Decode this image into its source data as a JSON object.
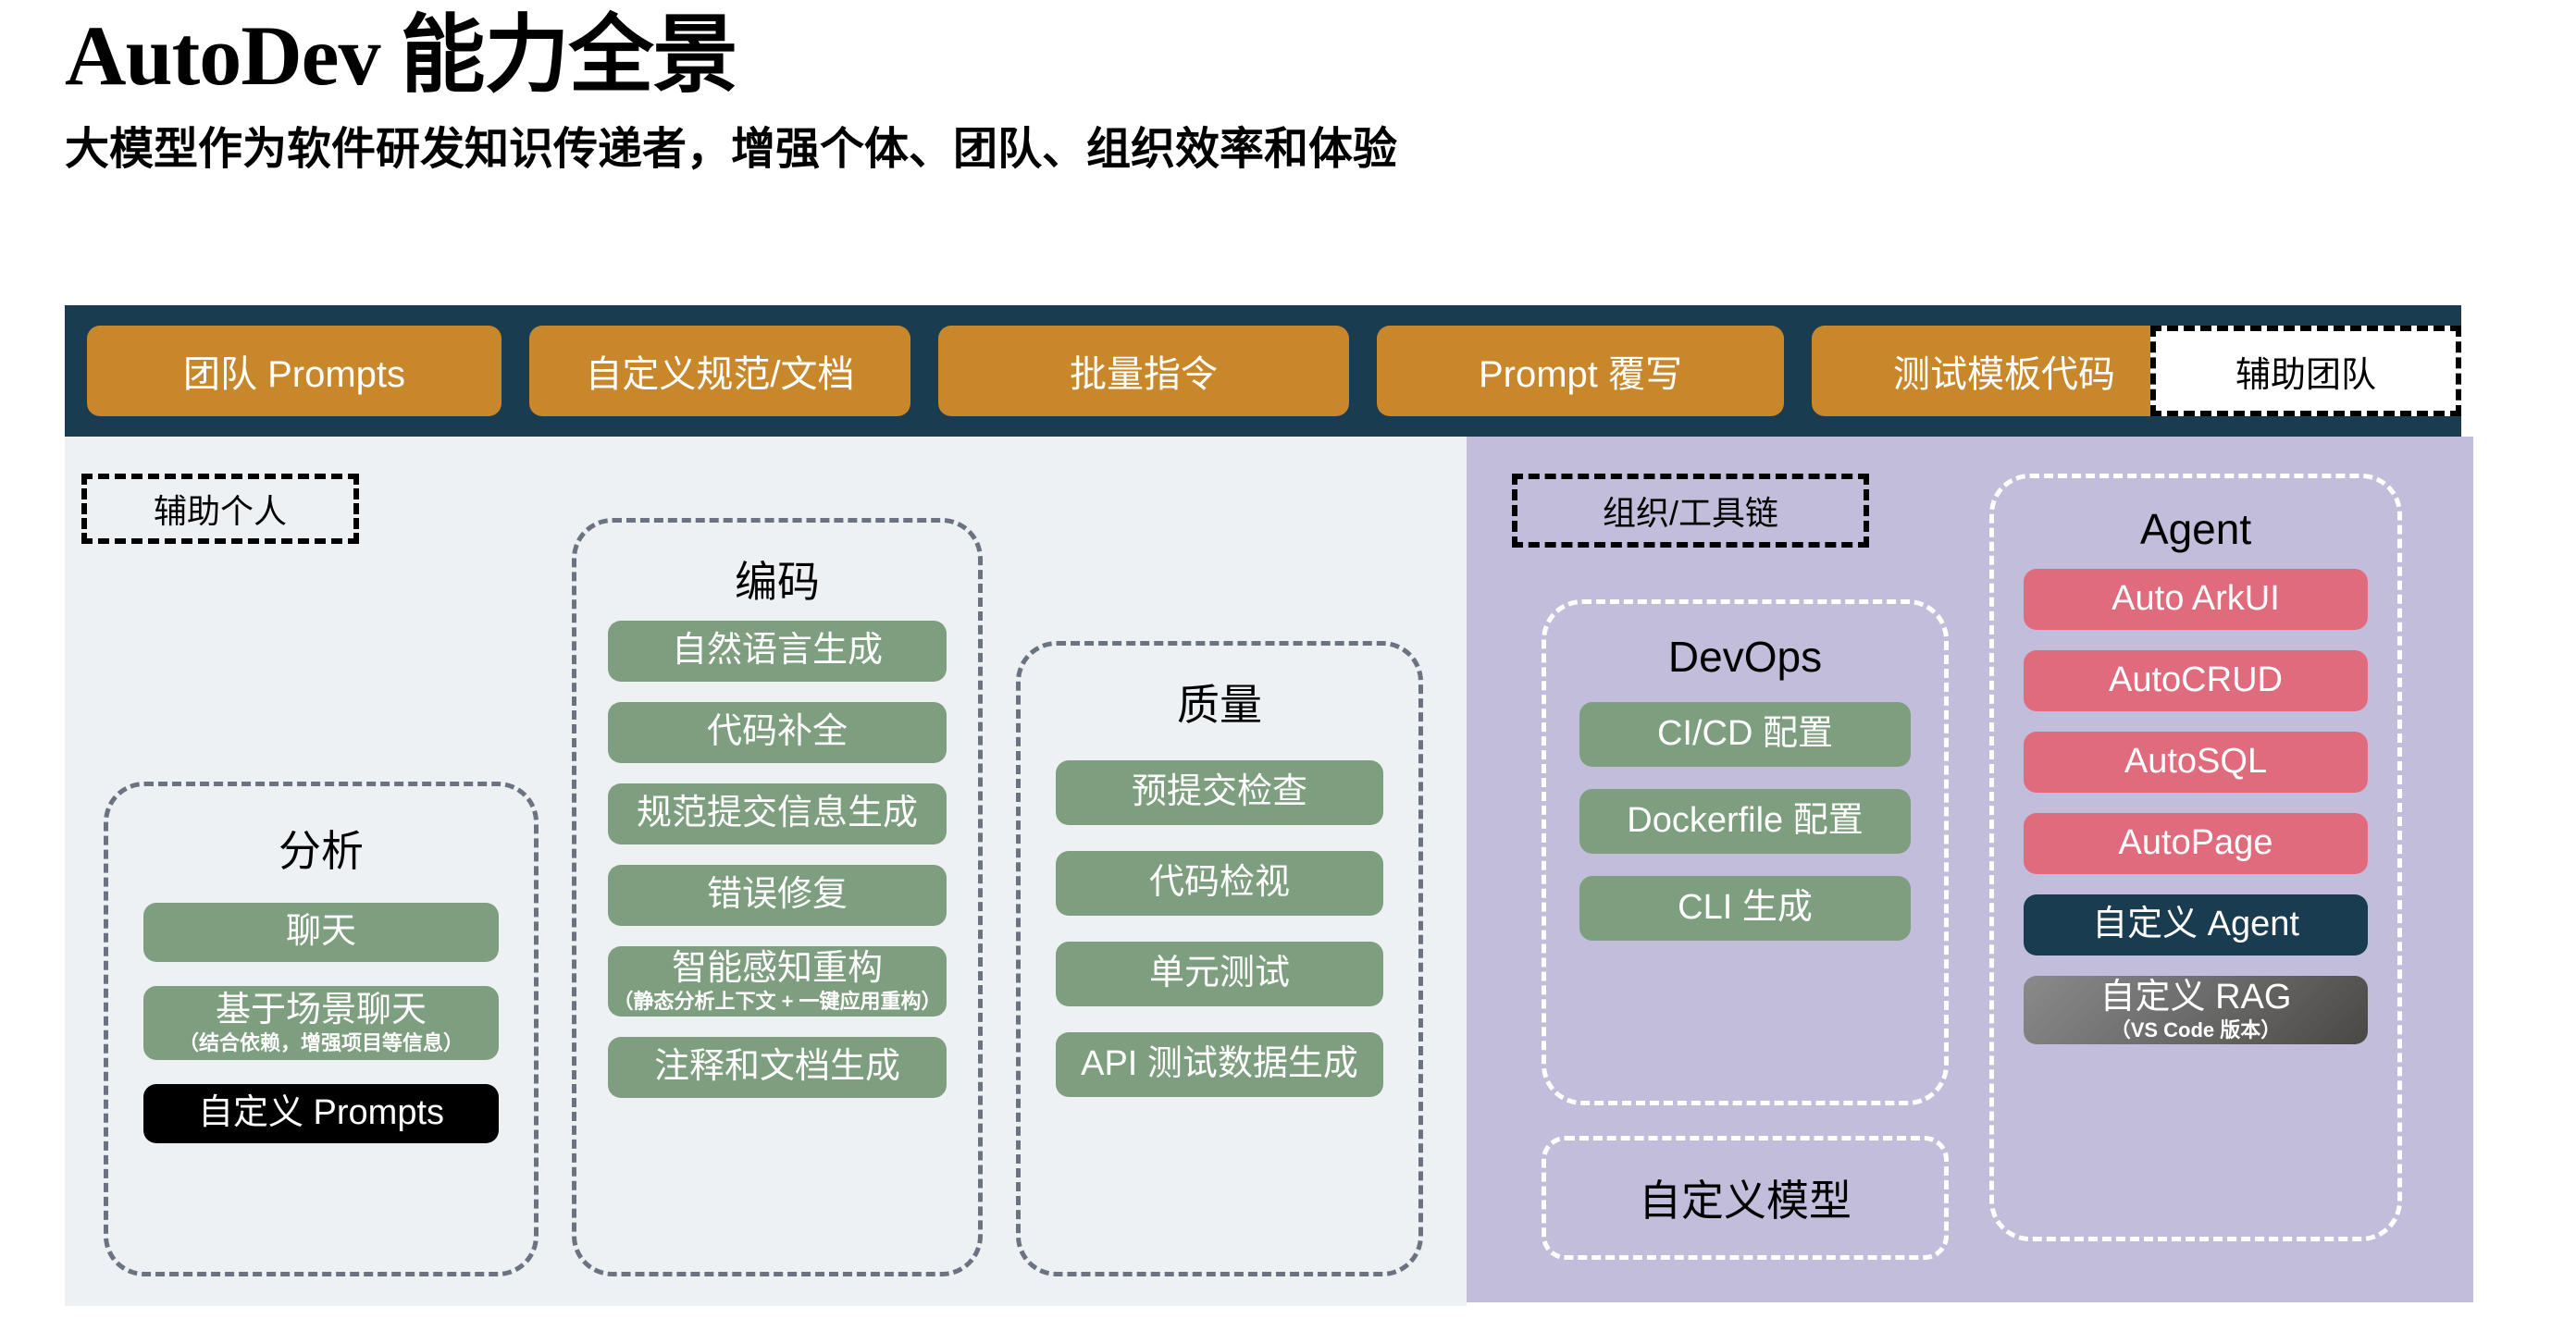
{
  "header": {
    "title": "AutoDev 能力全景",
    "subtitle": "大模型作为软件研发知识传递者，增强个体、团队、组织效率和体验"
  },
  "topbar": {
    "chips": [
      {
        "label": "团队 Prompts"
      },
      {
        "label": "自定义规范/文档"
      },
      {
        "label": "批量指令"
      },
      {
        "label": "Prompt 覆写"
      },
      {
        "label": "测试模板代码"
      }
    ],
    "assist_team_label": "辅助团队"
  },
  "left_panel": {
    "label": "辅助个人",
    "groups": [
      {
        "title": "分析",
        "items": [
          {
            "main": "聊天",
            "sub": "",
            "style": "green"
          },
          {
            "main": "基于场景聊天",
            "sub": "（结合依赖，增强项目等信息）",
            "style": "green"
          },
          {
            "main": "自定义 Prompts",
            "sub": "",
            "style": "black"
          }
        ]
      },
      {
        "title": "编码",
        "items": [
          {
            "main": "自然语言生成",
            "sub": "",
            "style": "green"
          },
          {
            "main": "代码补全",
            "sub": "",
            "style": "green"
          },
          {
            "main": "规范提交信息生成",
            "sub": "",
            "style": "green"
          },
          {
            "main": "错误修复",
            "sub": "",
            "style": "green"
          },
          {
            "main": "智能感知重构",
            "sub": "（静态分析上下文 + 一键应用重构）",
            "style": "green"
          },
          {
            "main": "注释和文档生成",
            "sub": "",
            "style": "green"
          }
        ]
      },
      {
        "title": "质量",
        "items": [
          {
            "main": "预提交检查",
            "sub": "",
            "style": "green"
          },
          {
            "main": "代码检视",
            "sub": "",
            "style": "green"
          },
          {
            "main": "单元测试",
            "sub": "",
            "style": "green"
          },
          {
            "main": "API 测试数据生成",
            "sub": "",
            "style": "green"
          }
        ]
      }
    ]
  },
  "right_panel": {
    "label": "组织/工具链",
    "custom_model_label": "自定义模型",
    "groups": [
      {
        "title": "DevOps",
        "items": [
          {
            "main": "CI/CD 配置",
            "sub": "",
            "style": "green"
          },
          {
            "main": "Dockerfile 配置",
            "sub": "",
            "style": "green"
          },
          {
            "main": "CLI 生成",
            "sub": "",
            "style": "green"
          }
        ]
      },
      {
        "title": "Agent",
        "items": [
          {
            "main": "Auto ArkUI",
            "sub": "",
            "style": "pink"
          },
          {
            "main": "AutoCRUD",
            "sub": "",
            "style": "pink"
          },
          {
            "main": "AutoSQL",
            "sub": "",
            "style": "pink"
          },
          {
            "main": "AutoPage",
            "sub": "",
            "style": "pink"
          },
          {
            "main": "自定义 Agent",
            "sub": "",
            "style": "navy"
          },
          {
            "main": "自定义 RAG",
            "sub": "（VS Code 版本）",
            "style": "gray-grad"
          }
        ]
      }
    ]
  },
  "colors": {
    "navy": "#1a3c50",
    "orange": "#c8872b",
    "green": "#7e9f7f",
    "pink": "#e06b7d",
    "purple_panel": "#c2bdda",
    "gray_panel": "#edf1f3"
  }
}
